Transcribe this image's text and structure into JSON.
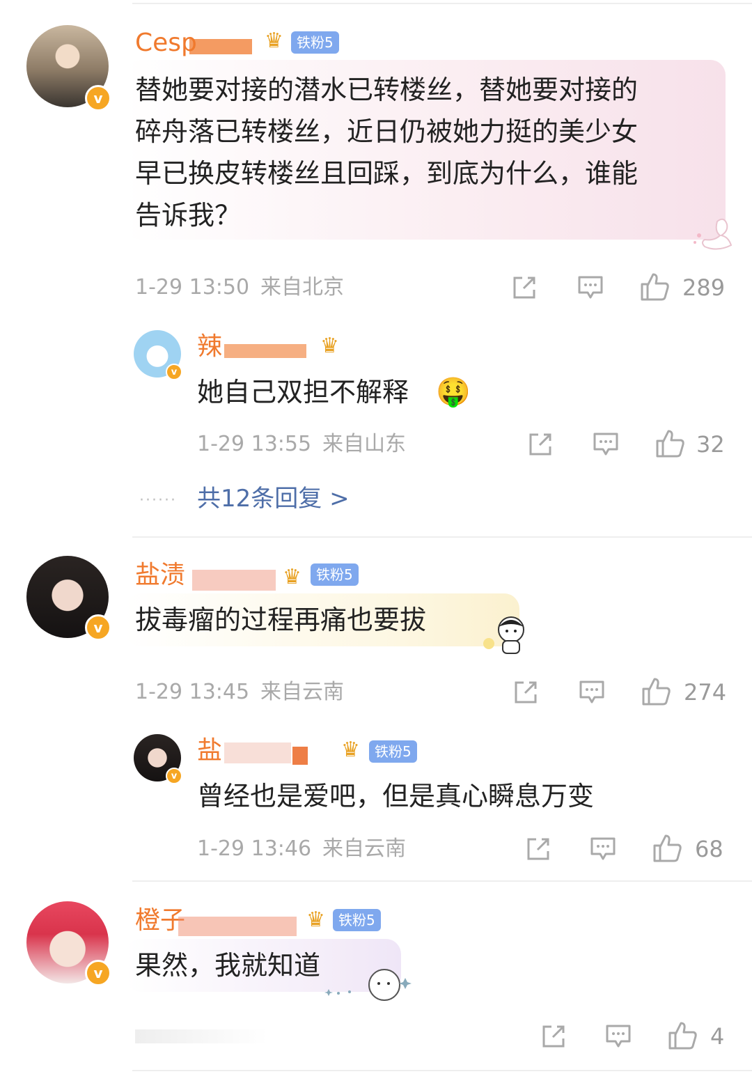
{
  "comments": [
    {
      "username_visible": "Cesp",
      "fan_badge": "铁粉5",
      "text_lines": [
        "替她要对接的潜水已转楼丝，替她要对接的",
        "碎舟落已转楼丝，近日仍被她力挺的美少女",
        "早已换皮转楼丝且回踩，到底为什么，谁能",
        "告诉我？"
      ],
      "time": "1-29 13:50",
      "location": "来自北京",
      "likes": "289",
      "reply": {
        "username_visible": "辣",
        "text": "她自己双担不解释",
        "emoji": "🤑",
        "time": "1-29 13:55",
        "location": "来自山东",
        "likes": "32"
      },
      "more_replies": "共12条回复 >"
    },
    {
      "username_visible": "盐渍",
      "fan_badge": "铁粉5",
      "text": "拔毒瘤的过程再痛也要拔",
      "time": "1-29 13:45",
      "location": "来自云南",
      "likes": "274",
      "reply": {
        "username_visible": "盐",
        "fan_badge": "铁粉5",
        "text": "曾经也是爱吧，但是真心瞬息万变",
        "time": "1-29 13:46",
        "location": "来自云南",
        "likes": "68"
      }
    },
    {
      "username_visible": "橙子",
      "fan_badge": "铁粉5",
      "text": "果然，我就知道",
      "likes": "4"
    }
  ],
  "colors": {
    "username": "#f07a2e",
    "fan_badge": "#7fa8ee",
    "meta": "#a9a9a9",
    "link": "#4e6ea8",
    "verified": "#f6a623"
  },
  "icons": [
    "share-icon",
    "comment-icon",
    "like-icon",
    "crown-icon",
    "verified-icon"
  ]
}
